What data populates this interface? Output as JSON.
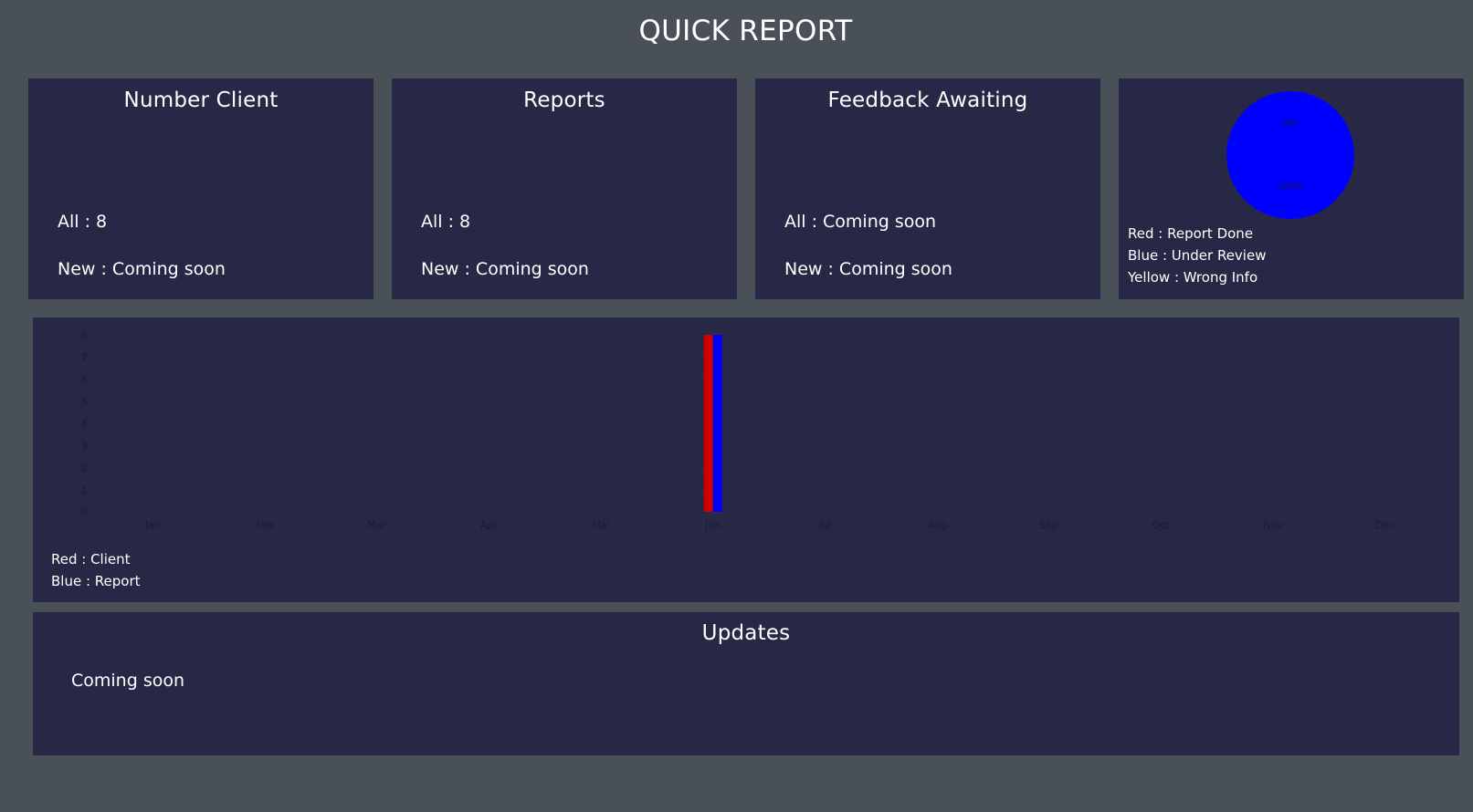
{
  "header": {
    "title": "QUICK REPORT"
  },
  "cards": {
    "clients": {
      "title": "Number Client",
      "all": "All : 8",
      "new": "New : Coming soon"
    },
    "reports": {
      "title": "Reports",
      "all": "All : 8",
      "new": "New : Coming soon"
    },
    "feedback": {
      "title": "Feedback Awaiting",
      "all": "All : Coming soon",
      "new": "New : Coming soon"
    }
  },
  "pie_card": {
    "legend": [
      "Red : Report Done",
      "Blue : Under Review",
      "Yellow : Wrong Info"
    ]
  },
  "bar_card": {
    "legend": [
      "Red : Client",
      "Blue : Report"
    ]
  },
  "updates": {
    "title": "Updates",
    "body": "Coming soon"
  },
  "colors": {
    "page_bg": "#495057",
    "card_bg": "#272846",
    "red": "#d10000",
    "blue": "#0000ff",
    "yellow": "#ffff00"
  },
  "chart_data": [
    {
      "type": "pie",
      "categories": [
        "Report Done",
        "Under Review",
        "Wrong Info"
      ],
      "values": [
        0,
        100,
        0
      ],
      "labels": [
        "0%",
        "100%"
      ],
      "colors": [
        "#d10000",
        "#0000ff",
        "#ffff00"
      ]
    },
    {
      "type": "bar",
      "categories": [
        "Jan",
        "Feb",
        "Mar",
        "Apr",
        "Mai",
        "Jun",
        "Jul",
        "Aug",
        "Sep",
        "Oct",
        "Nov",
        "Dec"
      ],
      "series": [
        {
          "values": [
            0,
            0,
            0,
            0,
            0,
            8,
            0,
            0,
            0,
            0,
            0,
            0
          ],
          "color": "#d10000"
        },
        {
          "values": [
            0,
            0,
            0,
            0,
            0,
            8,
            0,
            0,
            0,
            0,
            0,
            0
          ],
          "color": "#0000ff"
        }
      ],
      "ylim": [
        0,
        8
      ],
      "yticks": [
        0,
        1,
        2,
        3,
        4,
        5,
        6,
        7,
        8
      ],
      "grid": true
    }
  ]
}
